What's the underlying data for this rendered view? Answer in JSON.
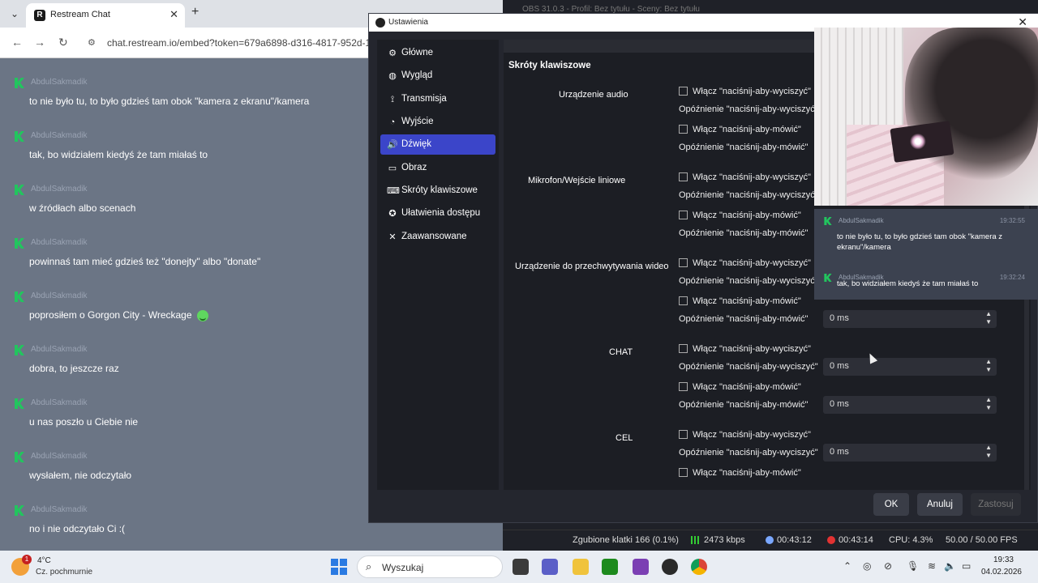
{
  "browser": {
    "tab_title": "Restream Chat",
    "url": "chat.restream.io/embed?token=679a6898-d316-4817-952d-1..."
  },
  "chat_messages": [
    {
      "author": "AbdulSakmadik",
      "text": "to nie było tu, to było gdzieś tam obok \"kamera z ekranu\"/kamera"
    },
    {
      "author": "AbdulSakmadik",
      "text": "tak, bo widziałem kiedyś że tam miałaś to"
    },
    {
      "author": "AbdulSakmadik",
      "text": "w źródłach albo scenach"
    },
    {
      "author": "AbdulSakmadik",
      "text": "powinnaś tam mieć gdzieś też \"donejty\" albo \"donate\""
    },
    {
      "author": "AbdulSakmadik",
      "text": "poprosiłem o Gorgon City - Wreckage"
    },
    {
      "author": "AbdulSakmadik",
      "text": "dobra, to jeszcze raz"
    },
    {
      "author": "AbdulSakmadik",
      "text": "u nas poszło u Ciebie nie"
    },
    {
      "author": "AbdulSakmadik",
      "text": "wysłałem, nie odczytało"
    },
    {
      "author": "AbdulSakmadik",
      "text": "no i nie odczytało Ci :("
    }
  ],
  "obs_bg_title": "OBS 31.0.3 - Profil: Bez tytułu - Sceny: Bez tytułu",
  "dialog": {
    "title": "Ustawienia",
    "sidebar": [
      {
        "label": "Główne",
        "icon": "gear-icon",
        "glyph": "⚙"
      },
      {
        "label": "Wygląd",
        "icon": "brush-icon",
        "glyph": "◍"
      },
      {
        "label": "Transmisja",
        "icon": "antenna-icon",
        "glyph": "⟟"
      },
      {
        "label": "Wyjście",
        "icon": "output-icon",
        "glyph": "◔"
      },
      {
        "label": "Dźwięk",
        "icon": "speaker-icon",
        "glyph": "🔊"
      },
      {
        "label": "Obraz",
        "icon": "monitor-icon",
        "glyph": "▭"
      },
      {
        "label": "Skróty klawiszowe",
        "icon": "keyboard-icon",
        "glyph": "⌨"
      },
      {
        "label": "Ułatwienia dostępu",
        "icon": "accessibility-icon",
        "glyph": "✪"
      },
      {
        "label": "Zaawansowane",
        "icon": "tools-icon",
        "glyph": "✕"
      }
    ],
    "active_item": "Dźwięk",
    "section_title": "Skróty klawiszowe",
    "groups": [
      {
        "label": "Urządzenie audio"
      },
      {
        "label": "Mikrofon/Wejście liniowe"
      },
      {
        "label": "Urządzenie do przechwytywania wideo"
      },
      {
        "label": "CHAT"
      },
      {
        "label": "CEL"
      }
    ],
    "checkbox_ptm": "Włącz \"naciśnij-aby-wyciszyć\"",
    "checkbox_ptt": "Włącz \"naciśnij-aby-mówić\"",
    "delay_ptm": "Opóźnienie \"naciśnij-aby-wyciszyć\"",
    "delay_ptt": "Opóźnienie \"naciśnij-aby-mówić\"",
    "spin_value": "0 ms",
    "buttons": {
      "ok": "OK",
      "cancel": "Anuluj",
      "apply": "Zastosuj"
    }
  },
  "overlay_messages": [
    {
      "author": "AbdulSakmadik",
      "time": "19:32:55",
      "text": "to nie było tu, to było gdzieś tam obok \"kamera z ekranu\"/kamera"
    },
    {
      "author": "AbdulSakmadik",
      "time": "19:32:24",
      "text": "tak, bo widziałem kiedyś że tam miałaś to"
    }
  ],
  "obs_status": {
    "dropped": "Zgubione klatki 166 (0.1%)",
    "bitrate": "2473 kbps",
    "stream_time": "00:43:12",
    "rec_time": "00:43:14",
    "cpu": "CPU: 4.3%",
    "fps": "50.00 / 50.00 FPS"
  },
  "taskbar": {
    "weather_temp": "4°C",
    "weather_desc": "Cz. pochmurnie",
    "weather_badge": "1",
    "search_placeholder": "Wyszukaj",
    "time": "19:33",
    "date": "04.02.2026"
  },
  "colors": {
    "accent": "#3b45c9",
    "restream_green": "#22c55e"
  }
}
